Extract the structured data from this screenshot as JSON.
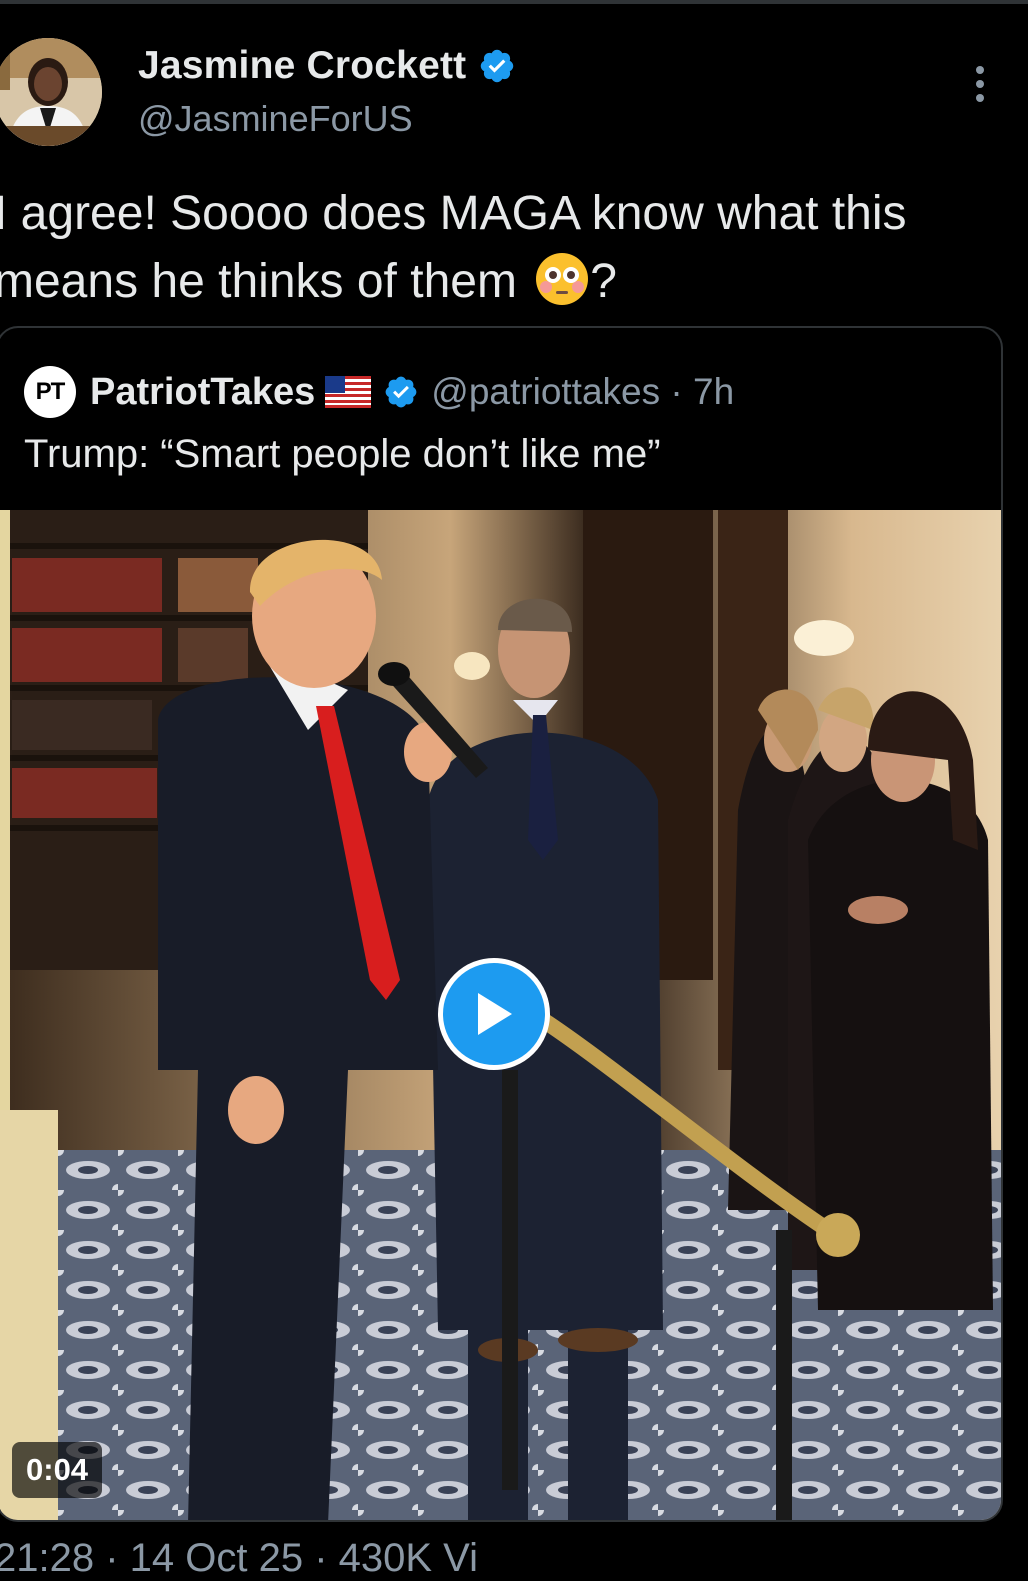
{
  "author": {
    "name": "Jasmine Crockett",
    "handle": "@JasmineForUS",
    "verified_color": "#1d9bf0"
  },
  "tweet": {
    "text": "I agree! Soooo does MAGA know what this means he thinks of them",
    "emoji": "flushed-face-icon",
    "text_tail": "?"
  },
  "quoted": {
    "logo_text": "PT",
    "name": "PatriotTakes",
    "flag": "us-flag-icon",
    "handle_time": "@patriottakes · 7h",
    "text": "Trump: “Smart people don’t like me”",
    "video": {
      "duration": "0:04",
      "play_icon": "play-icon"
    }
  },
  "meta": {
    "partial_text": "21:28 · 14 Oct 25 · 430K Vi"
  },
  "colors": {
    "background": "#000000",
    "text": "#e7e9ea",
    "secondary": "#8b98a5",
    "accent": "#1d9bf0",
    "border": "#2f3336"
  }
}
